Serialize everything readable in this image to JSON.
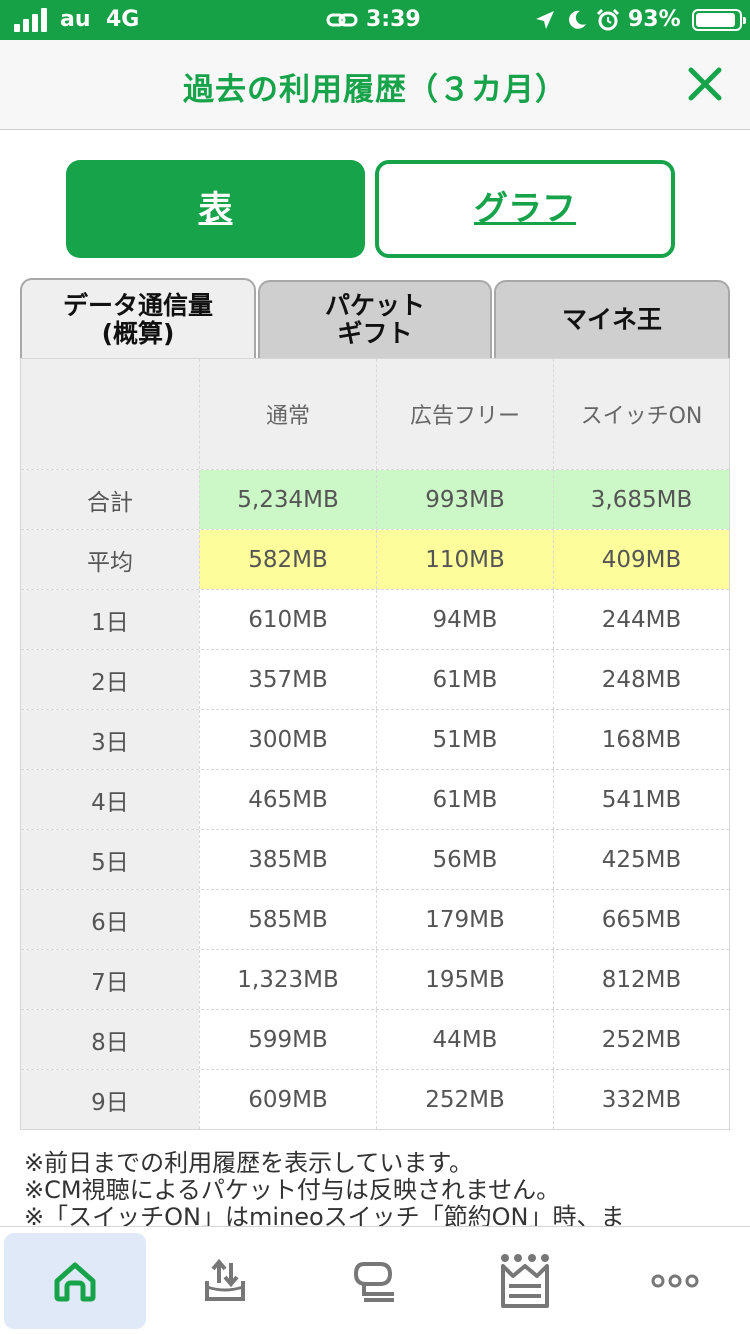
{
  "status_bar": {
    "carrier": "au",
    "network": "4G",
    "time": "3:39",
    "battery": "93%",
    "battery_level": 0.93
  },
  "header": {
    "title": "過去の利用履歴（３カ月）",
    "close_icon": "close-icon"
  },
  "view_toggle": {
    "table_label": "表",
    "graph_label": "グラフ"
  },
  "tabs": [
    {
      "label": "データ通信量\n(概算)",
      "active": true
    },
    {
      "label": "パケット\nギフト",
      "active": false
    },
    {
      "label": "マイネ王",
      "active": false
    }
  ],
  "table": {
    "columns": [
      "",
      "通常",
      "広告フリー",
      "スイッチON"
    ],
    "total": {
      "label": "合計",
      "values": [
        "5,234MB",
        "993MB",
        "3,685MB"
      ]
    },
    "average": {
      "label": "平均",
      "values": [
        "582MB",
        "110MB",
        "409MB"
      ]
    },
    "rows": [
      {
        "label": "1日",
        "values": [
          "610MB",
          "94MB",
          "244MB"
        ]
      },
      {
        "label": "2日",
        "values": [
          "357MB",
          "61MB",
          "248MB"
        ]
      },
      {
        "label": "3日",
        "values": [
          "300MB",
          "51MB",
          "168MB"
        ]
      },
      {
        "label": "4日",
        "values": [
          "465MB",
          "61MB",
          "541MB"
        ]
      },
      {
        "label": "5日",
        "values": [
          "385MB",
          "56MB",
          "425MB"
        ]
      },
      {
        "label": "6日",
        "values": [
          "585MB",
          "179MB",
          "665MB"
        ]
      },
      {
        "label": "7日",
        "values": [
          "1,323MB",
          "195MB",
          "812MB"
        ]
      },
      {
        "label": "8日",
        "values": [
          "599MB",
          "44MB",
          "252MB"
        ]
      },
      {
        "label": "9日",
        "values": [
          "609MB",
          "252MB",
          "332MB"
        ]
      }
    ]
  },
  "notes": [
    "※前日までの利用履歴を表示しています。",
    "※CM視聴によるパケット付与は反映されません。",
    "※「スイッチON」はmineoスイッチ「節約ON」時、ま"
  ],
  "bottom_nav": [
    {
      "icon": "home-icon",
      "active": true
    },
    {
      "icon": "upload-icon",
      "active": false
    },
    {
      "icon": "chat-icon",
      "active": false
    },
    {
      "icon": "crown-icon",
      "active": false
    },
    {
      "icon": "more-icon",
      "active": false
    }
  ],
  "colors": {
    "brand_green": "#17a349",
    "status_bar_green": "#16a147",
    "total_row": "#ccf8c7",
    "average_row": "#fdfd9b"
  }
}
